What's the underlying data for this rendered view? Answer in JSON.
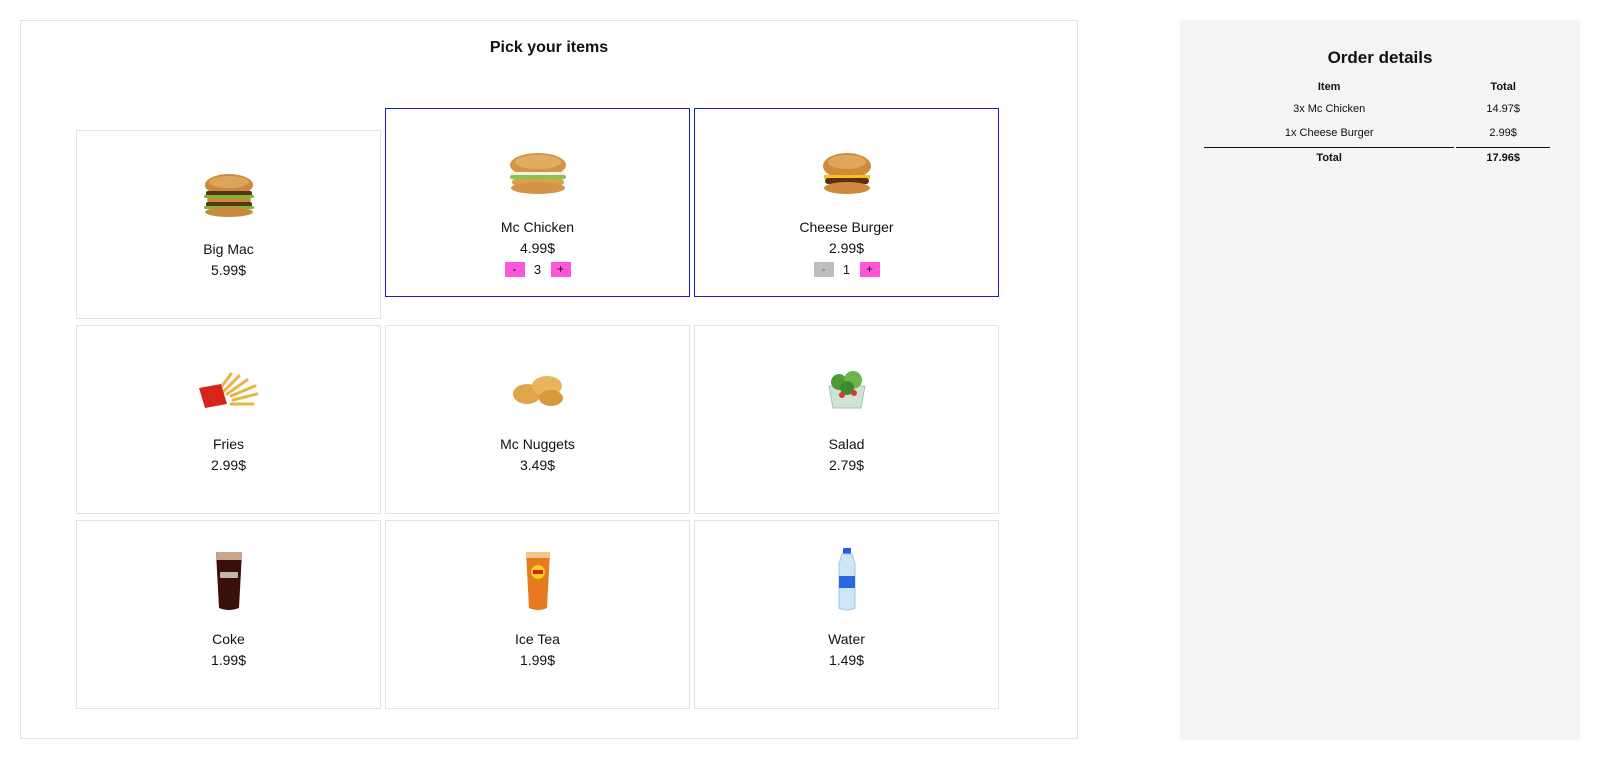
{
  "picker": {
    "title": "Pick your items",
    "items": [
      {
        "id": "big-mac",
        "name": "Big Mac",
        "price": "5.99$",
        "icon": "burger-icon",
        "selected": false
      },
      {
        "id": "mc-chicken",
        "name": "Mc Chicken",
        "price": "4.99$",
        "icon": "chicken-sandwich-icon",
        "selected": true,
        "qty": "3",
        "minus": "-",
        "plus": "+",
        "minus_disabled": false
      },
      {
        "id": "cheese-burger",
        "name": "Cheese Burger",
        "price": "2.99$",
        "icon": "cheeseburger-icon",
        "selected": true,
        "qty": "1",
        "minus": "-",
        "plus": "+",
        "minus_disabled": true
      },
      {
        "id": "fries",
        "name": "Fries",
        "price": "2.99$",
        "icon": "fries-icon",
        "selected": false
      },
      {
        "id": "mc-nuggets",
        "name": "Mc Nuggets",
        "price": "3.49$",
        "icon": "nuggets-icon",
        "selected": false
      },
      {
        "id": "salad",
        "name": "Salad",
        "price": "2.79$",
        "icon": "salad-icon",
        "selected": false
      },
      {
        "id": "coke",
        "name": "Coke",
        "price": "1.99$",
        "icon": "cola-glass-icon",
        "selected": false
      },
      {
        "id": "ice-tea",
        "name": "Ice Tea",
        "price": "1.99$",
        "icon": "ice-tea-glass-icon",
        "selected": false
      },
      {
        "id": "water",
        "name": "Water",
        "price": "1.49$",
        "icon": "water-bottle-icon",
        "selected": false
      }
    ]
  },
  "order": {
    "title": "Order details",
    "headers": {
      "item": "Item",
      "total": "Total"
    },
    "rows": [
      {
        "item": "3x Mc Chicken",
        "total": "14.97$"
      },
      {
        "item": "1x Cheese Burger",
        "total": "2.99$"
      }
    ],
    "summary": {
      "label": "Total",
      "value": "17.96$"
    }
  },
  "colors": {
    "selected_border": "#1a1adf",
    "qty_button": "#ff55dd",
    "qty_button_disabled": "#bdbdbd",
    "order_panel_bg": "#f4f4f4"
  }
}
